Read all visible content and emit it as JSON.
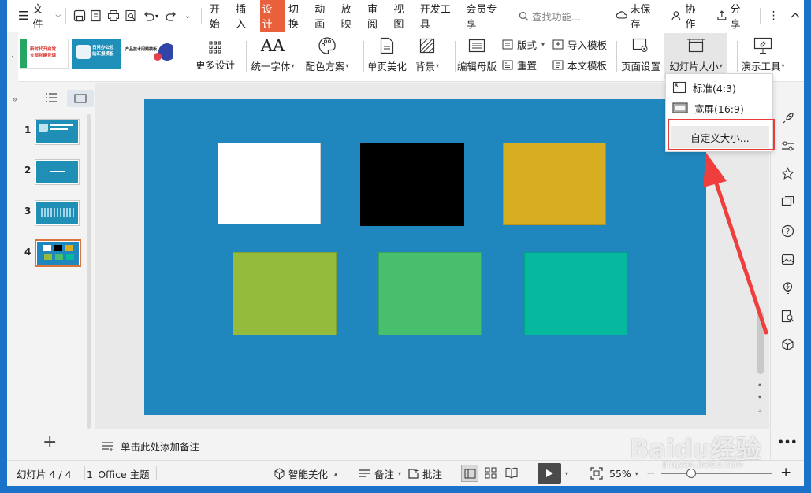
{
  "menubar": {
    "file_label": "文件",
    "tabs": [
      "开始",
      "插入",
      "设计",
      "切换",
      "动画",
      "放映",
      "审阅",
      "视图",
      "开发工具",
      "会员专享"
    ],
    "active_tab": "设计",
    "search_placeholder": "查找功能...",
    "unsaved_label": "未保存",
    "collab_label": "协作",
    "share_label": "分享"
  },
  "ribbon": {
    "template_thumbs": [
      {
        "title": "新时代开启党\n支部党建党课"
      },
      {
        "title": "日常办公总\n结汇报模板"
      },
      {
        "title": "产品技术问题模板"
      }
    ],
    "more_design": "更多设计",
    "unify_font": "统一字体",
    "color_scheme": "配色方案",
    "single_page_beautify": "单页美化",
    "background": "背景",
    "edit_master": "编辑母版",
    "layout": "版式",
    "reset": "重置",
    "import_template": "导入模板",
    "text_template": "本文模板",
    "page_setup": "页面设置",
    "slide_size": "幻灯片大小",
    "presentation_tools": "演示工具"
  },
  "dropdown": {
    "standard": "标准(4:3)",
    "widescreen": "宽屏(16:9)",
    "custom": "自定义大小..."
  },
  "slides": [
    {
      "num": "1"
    },
    {
      "num": "2"
    },
    {
      "num": "3"
    },
    {
      "num": "4"
    }
  ],
  "notes_placeholder": "单击此处添加备注",
  "statusbar": {
    "slide_counter": "幻灯片 4 / 4",
    "theme": "1_Office 主题",
    "smart_beautify": "智能美化",
    "notes": "备注",
    "comments": "批注",
    "zoom": "55%"
  },
  "colors": {
    "slide_bg": "#1f87bd",
    "shape_white": "#ffffff",
    "shape_black": "#000000",
    "shape_gold": "#d6ae1f",
    "shape_olive": "#95bb3c",
    "shape_green": "#48bf6d",
    "shape_teal": "#05b99f",
    "accent_tab": "#e8603c",
    "highlight": "#e93b3b"
  },
  "watermark": "Baidu经验",
  "watermark_sub": "jingyan.baidu.com"
}
